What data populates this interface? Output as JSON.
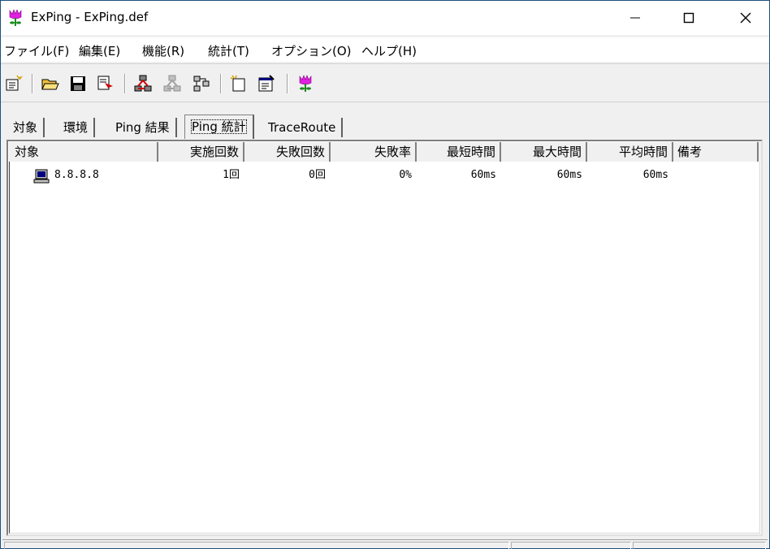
{
  "window": {
    "title": "ExPing - ExPing.def",
    "minimize_glyph": "—",
    "maximize_glyph": "☐",
    "close_glyph": "✕"
  },
  "menu": [
    "ファイル(F)",
    "編集(E)",
    "機能(R)",
    "統計(T)",
    "オプション(O)",
    "ヘルプ(H)"
  ],
  "toolbar": {
    "icons": [
      "new-target-icon",
      "open-folder-icon",
      "save-icon",
      "save-as-icon",
      "run-ping-icon",
      "stop-ping-icon",
      "traceroute-icon",
      "new-file-icon",
      "properties-icon",
      "about-icon"
    ]
  },
  "tabs": [
    "対象",
    "環境",
    "Ping 結果",
    "Ping 統計",
    "TraceRoute"
  ],
  "active_tab": "Ping 統計",
  "table": {
    "columns": [
      "対象",
      "実施回数",
      "失敗回数",
      "失敗率",
      "最短時間",
      "最大時間",
      "平均時間",
      "備考"
    ],
    "rows": [
      {
        "target": "8.8.8.8",
        "attempts": "1回",
        "failures": "0回",
        "failure_rate": "0%",
        "min_time": "60ms",
        "max_time": "60ms",
        "avg_time": "60ms",
        "note": ""
      }
    ]
  },
  "colors": {
    "accent_border": "#1f4f7f",
    "icon_magenta": "#e020e0",
    "icon_green": "#1a8a1a"
  }
}
